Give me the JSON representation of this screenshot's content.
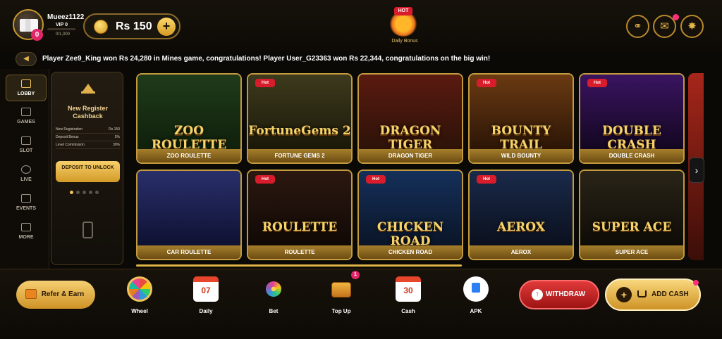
{
  "header": {
    "username": "Mueez1122",
    "vip": "VIP 0",
    "vip_progress": "0/1,000",
    "avatar_badge": "0",
    "balance": "Rs 150",
    "balance_plus": "+",
    "daily_bonus": {
      "hot": "HOT",
      "label": "Daily Bonus"
    },
    "icons": [
      "headset-icon",
      "mail-icon",
      "settings-icon"
    ]
  },
  "ticker": {
    "text": "Player Zee9_King won Rs 24,280 in Mines game, congratulations! Player User_G23363 won Rs 22,344, congratulations on the big win!"
  },
  "sidebar": {
    "items": [
      {
        "label": "LOBBY",
        "icon": "lobby-icon",
        "active": true
      },
      {
        "label": "GAMES",
        "icon": "games-icon",
        "active": false
      },
      {
        "label": "SLOT",
        "icon": "slot-icon",
        "active": false
      },
      {
        "label": "LIVE",
        "icon": "live-icon",
        "active": false
      },
      {
        "label": "EVENTS",
        "icon": "events-icon",
        "active": false
      },
      {
        "label": "MORE",
        "icon": "more-icon",
        "active": false
      }
    ]
  },
  "promo": {
    "title": "New Register Cashback",
    "rows": [
      {
        "label": "New Registration",
        "value": "Rs 150"
      },
      {
        "label": "Deposit Bonus",
        "value": "5%"
      },
      {
        "label": "Level Commission",
        "value": "30%"
      }
    ],
    "button": "DEPOSIT TO UNLOCK"
  },
  "games": [
    {
      "name": "ZOO ROULETTE",
      "art": "ZOO ROULETTE",
      "hot": false,
      "colors": [
        "#1f3b1a",
        "#0f1f0b"
      ]
    },
    {
      "name": "FORTUNE GEMS 2",
      "art": "FortuneGems 2",
      "hot": true,
      "colors": [
        "#3d3a1d",
        "#1a1708"
      ]
    },
    {
      "name": "DRAGON TIGER",
      "art": "DRAGON TIGER",
      "hot": false,
      "colors": [
        "#5a1a10",
        "#2b1208"
      ]
    },
    {
      "name": "WILD BOUNTY",
      "art": "BOUNTY TRAIL",
      "hot": true,
      "colors": [
        "#6a3a12",
        "#2a1406"
      ]
    },
    {
      "name": "DOUBLE CRASH",
      "art": "DOUBLE CRASH",
      "hot": true,
      "colors": [
        "#3a1460",
        "#12061f"
      ]
    },
    {
      "name": "CAR ROULETTE",
      "art": "",
      "hot": false,
      "colors": [
        "#2a2f6a",
        "#0d1030"
      ]
    },
    {
      "name": "ROULETTE",
      "art": "ROULETTE",
      "hot": true,
      "colors": [
        "#2c1810",
        "#0f0805"
      ]
    },
    {
      "name": "CHICKEN ROAD",
      "art": "CHICKEN ROAD",
      "hot": true,
      "colors": [
        "#15305a",
        "#0a1426"
      ]
    },
    {
      "name": "AEROX",
      "art": "AEROX",
      "hot": true,
      "colors": [
        "#1a2a4a",
        "#0a0f1c"
      ]
    },
    {
      "name": "SUPER ACE",
      "art": "SUPER ACE",
      "hot": false,
      "colors": [
        "#2a2418",
        "#0d0b06"
      ]
    }
  ],
  "hot_tag": "Hot",
  "bottom": {
    "refer": "Refer & Earn",
    "shortcuts": [
      {
        "label": "Wheel",
        "icon": "wheel-icon"
      },
      {
        "label": "Daily",
        "icon": "calendar-icon",
        "num": "07"
      },
      {
        "label": "Bet",
        "icon": "bet-icon"
      },
      {
        "label": "Top Up",
        "icon": "chest-icon",
        "badge": "1"
      },
      {
        "label": "Cash",
        "icon": "calendar-icon",
        "num": "30"
      },
      {
        "label": "APK",
        "icon": "download-icon"
      }
    ],
    "withdraw": "WITHDRAW",
    "add_cash": "ADD CASH"
  }
}
